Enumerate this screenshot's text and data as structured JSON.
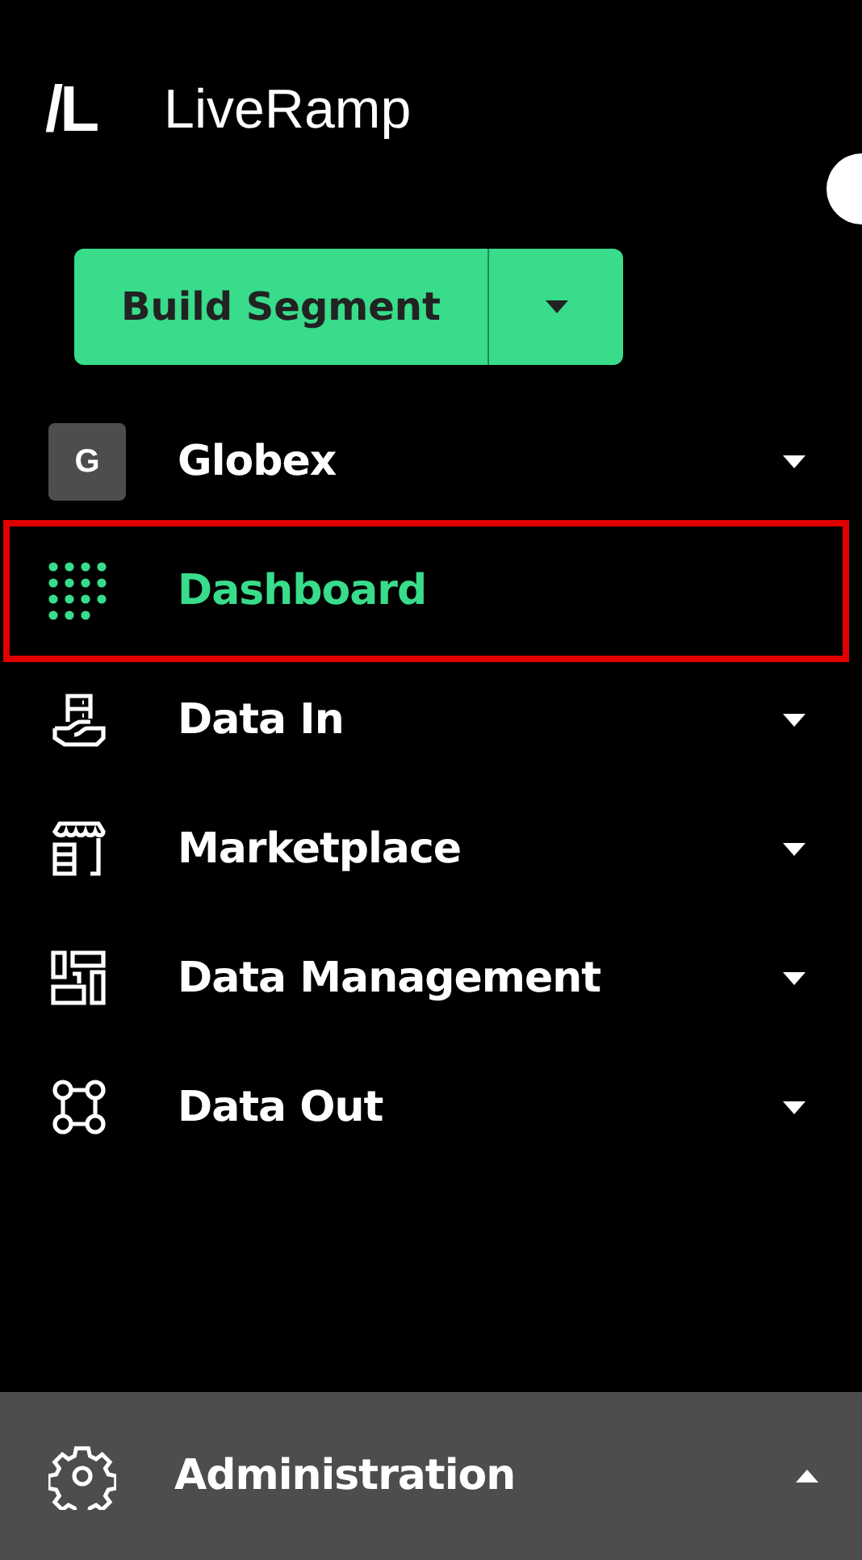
{
  "logo": {
    "mark": "/L",
    "name": "LiveRamp"
  },
  "primary_button": {
    "label": "Build Segment"
  },
  "nav": [
    {
      "kind": "org",
      "label": "Globex",
      "avatar": "G",
      "selected": false,
      "expanded": false
    },
    {
      "kind": "link",
      "label": "Dashboard",
      "selected": true
    },
    {
      "kind": "group",
      "label": "Data In",
      "selected": false,
      "expanded": false
    },
    {
      "kind": "group",
      "label": "Marketplace",
      "selected": false,
      "expanded": false
    },
    {
      "kind": "group",
      "label": "Data Management",
      "selected": false,
      "expanded": false
    },
    {
      "kind": "group",
      "label": "Data Out",
      "selected": false,
      "expanded": false
    }
  ],
  "footer": {
    "label": "Administration",
    "expanded": true
  }
}
